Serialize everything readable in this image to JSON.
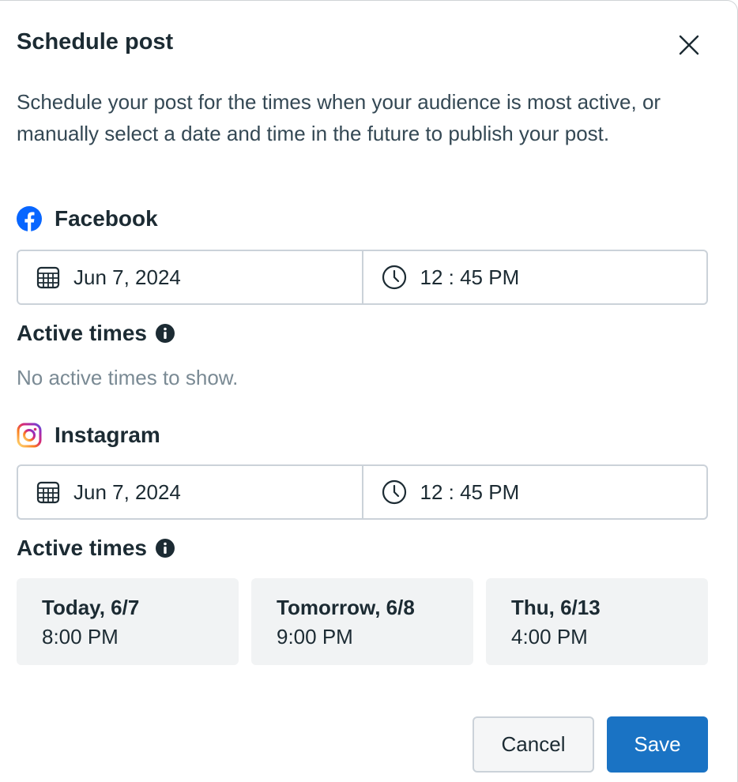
{
  "dialog": {
    "title": "Schedule post",
    "description": "Schedule your post for the times when your audience is most active, or manually select a date and time in the future to publish your post."
  },
  "facebook": {
    "label": "Facebook",
    "date": "Jun 7, 2024",
    "time": "12 : 45 PM",
    "active_times_label": "Active times",
    "empty_text": "No active times to show."
  },
  "instagram": {
    "label": "Instagram",
    "date": "Jun 7, 2024",
    "time": "12 : 45 PM",
    "active_times_label": "Active times",
    "suggestions": [
      {
        "day": "Today, 6/7",
        "time": "8:00 PM"
      },
      {
        "day": "Tomorrow, 6/8",
        "time": "9:00 PM"
      },
      {
        "day": "Thu, 6/13",
        "time": "4:00 PM"
      }
    ]
  },
  "footer": {
    "cancel_label": "Cancel",
    "save_label": "Save"
  },
  "colors": {
    "facebook_blue": "#0866ff",
    "save_button": "#1a73c4",
    "card_background": "#f1f3f4"
  },
  "icons": [
    "close-icon",
    "facebook-icon",
    "instagram-icon",
    "calendar-icon",
    "clock-icon",
    "info-icon"
  ]
}
